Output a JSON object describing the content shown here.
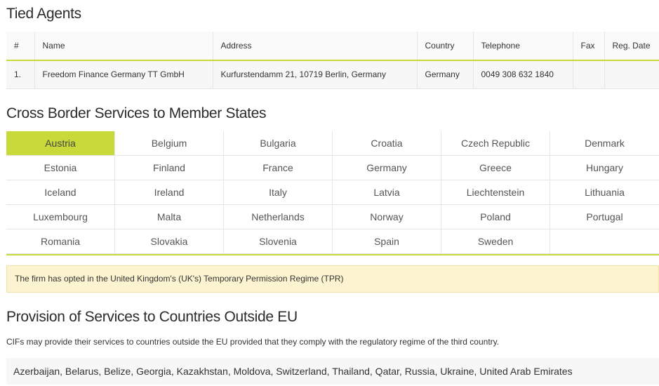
{
  "tied_agents": {
    "title": "Tied Agents",
    "headers": [
      "#",
      "Name",
      "Address",
      "Country",
      "Telephone",
      "Fax",
      "Reg. Date"
    ],
    "rows": [
      [
        "1.",
        "Freedom Finance Germany TT GmbH",
        "Kurfurstendamm 21, 10719 Berlin, Germany",
        "Germany",
        "0049 308 632 1840",
        "",
        ""
      ]
    ]
  },
  "cross_border": {
    "title": "Cross Border Services to Member States",
    "active_index": 0,
    "countries": [
      "Austria",
      "Belgium",
      "Bulgaria",
      "Croatia",
      "Czech Republic",
      "Denmark",
      "Estonia",
      "Finland",
      "France",
      "Germany",
      "Greece",
      "Hungary",
      "Iceland",
      "Ireland",
      "Italy",
      "Latvia",
      "Liechtenstein",
      "Lithuania",
      "Luxembourg",
      "Malta",
      "Netherlands",
      "Norway",
      "Poland",
      "Portugal",
      "Romania",
      "Slovakia",
      "Slovenia",
      "Spain",
      "Sweden",
      ""
    ]
  },
  "tpr_notice": "The firm has opted in the United Kingdom's (UK's) Temporary Permission Regime (TPR)",
  "outside_eu": {
    "title": "Provision of Services to Countries Outside EU",
    "description": "CIFs may provide their services to countries outside the EU provided that they comply with the regulatory regime of the third country.",
    "countries": "Azerbaijan, Belarus, Belize, Georgia, Kazakhstan, Moldova, Switzerland, Thailand, Qatar, Russia, Ukraine, United Arab Emirates"
  },
  "colors": {
    "accent": "#c8d93a",
    "notice_bg": "#fcf4d0",
    "row_bg": "#f7f7f7"
  }
}
